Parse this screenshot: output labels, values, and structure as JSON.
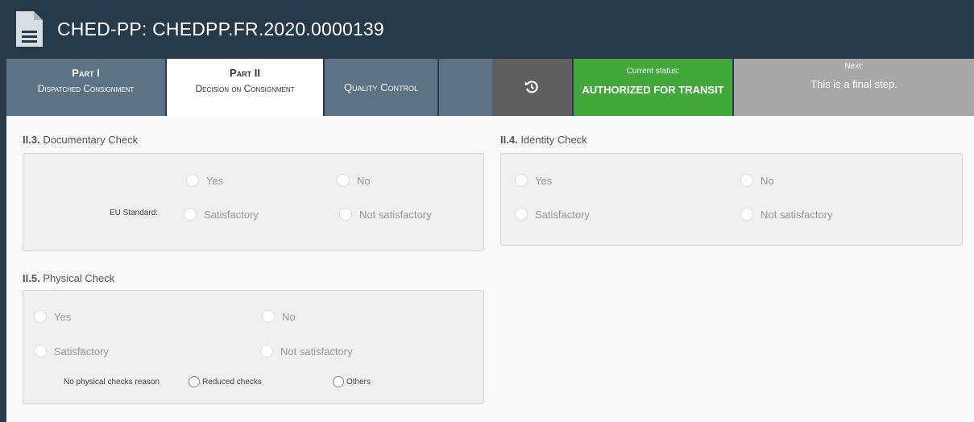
{
  "header": {
    "title": "CHED-PP: CHEDPP.FR.2020.0000139",
    "icon": "document-icon"
  },
  "tabs": [
    {
      "line1": "Part I",
      "line2": "Dispatched Consignment"
    },
    {
      "line1": "Part II",
      "line2": "Decision on Consignment"
    },
    {
      "line1": "Quality Control"
    }
  ],
  "history_icon": "history-icon",
  "status": {
    "caption": "Current status:",
    "value": "AUTHORIZED FOR TRANSIT",
    "color": "#43a83c"
  },
  "next": {
    "caption": "Next:",
    "value": "This is a final step."
  },
  "documentary_check": {
    "num": "II.3.",
    "title": "Documentary Check",
    "yes": "Yes",
    "no": "No",
    "standard_label": "EU Standard:",
    "satisfactory": "Satisfactory",
    "not_satisfactory": "Not satisfactory"
  },
  "identity_check": {
    "num": "II.4.",
    "title": "Identity Check",
    "yes": "Yes",
    "no": "No",
    "satisfactory": "Satisfactory",
    "not_satisfactory": "Not satisfactory"
  },
  "physical_check": {
    "num": "II.5.",
    "title": "Physical Check",
    "yes": "Yes",
    "no": "No",
    "satisfactory": "Satisfactory",
    "not_satisfactory": "Not satisfactory",
    "reason_label": "No physical checks reason",
    "reduced": "Reduced checks",
    "others": "Others"
  }
}
